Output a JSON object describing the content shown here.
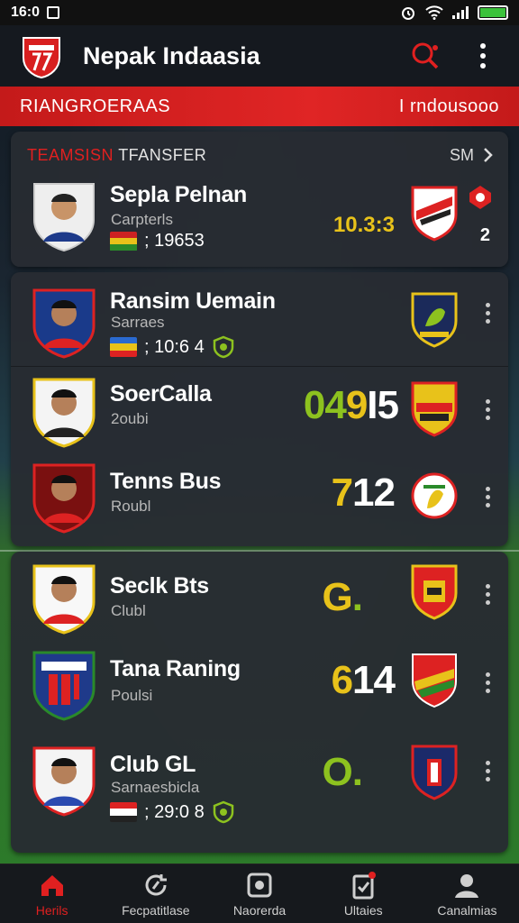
{
  "status": {
    "time": "16:0"
  },
  "app": {
    "title": "Nepak Indaasia"
  },
  "banner": {
    "left": "RIANGROERAAS",
    "right": "I rndousooo"
  },
  "card1": {
    "title_red": "TEAMSISN",
    "title_rest": " TFANSFER",
    "see_more": "SM",
    "rows": [
      {
        "name": "Sepla Pelnan",
        "club": "Carpterls",
        "meta": "; 19653",
        "score": "10.3:3",
        "rank": "2"
      }
    ]
  },
  "card2": {
    "rows": [
      {
        "name": "Ransim Uemain",
        "club": "Sarraes",
        "meta": "; 10:6 4"
      },
      {
        "name": "SoerCalla",
        "club": "2oubi",
        "score_g": "04",
        "score_y": "9",
        "score_w": "I5"
      },
      {
        "name": "Tenns Bus",
        "club": "Roubl",
        "score_y": "7",
        "score_w": "12"
      }
    ]
  },
  "card3": {
    "rows": [
      {
        "name": "Seclk Bts",
        "club": "Clubl",
        "score_y": "G",
        "score_dot": "."
      },
      {
        "name": "Tana Raning",
        "club": "Poulsi",
        "score_y": "6",
        "score_w": "14"
      },
      {
        "name": "Club GL",
        "club": "Sarnaesbicla",
        "meta": "; 29:0 8",
        "score_g": "O",
        "score_dot": "."
      }
    ]
  },
  "nav": [
    {
      "label": "Herils"
    },
    {
      "label": "Fecpatitlase"
    },
    {
      "label": "Naorerda"
    },
    {
      "label": "Ultaies"
    },
    {
      "label": "Canalmias"
    }
  ],
  "colors": {
    "accent": "#e02020",
    "score_green": "#8dc21f",
    "score_yellow": "#e8c21a"
  }
}
